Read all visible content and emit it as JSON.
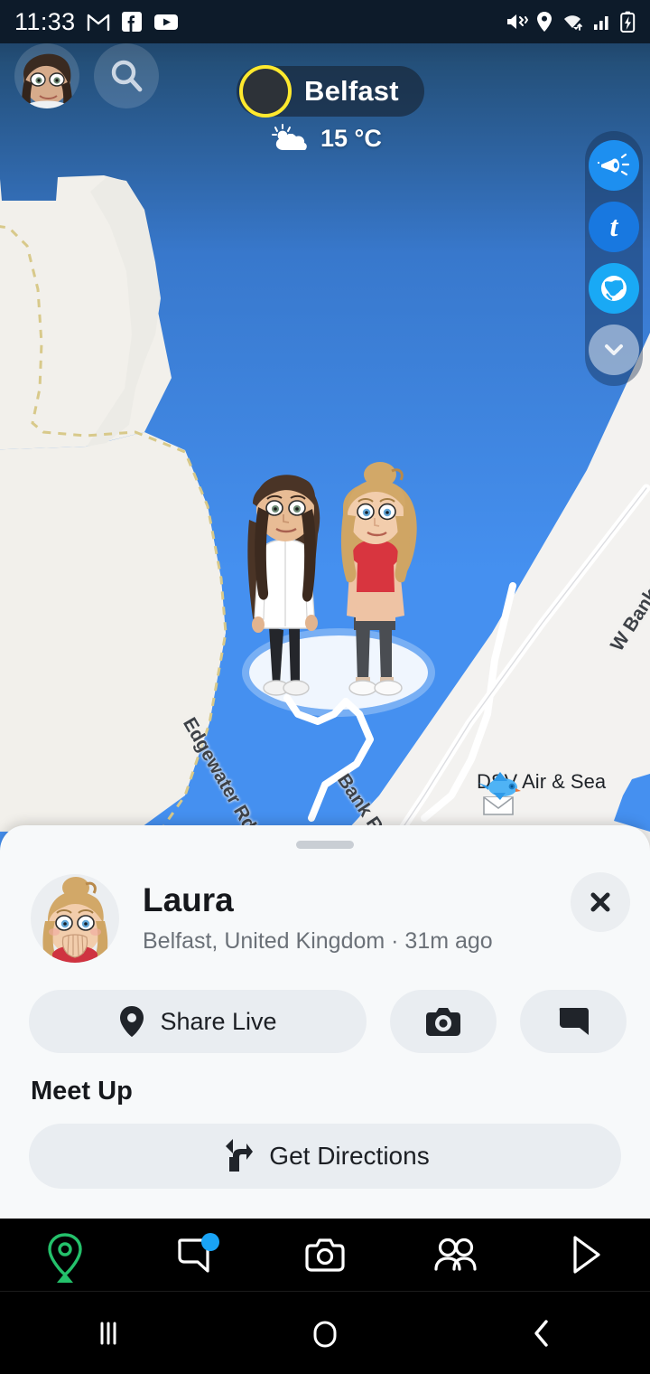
{
  "status_bar": {
    "time": "11:33",
    "left_icons": [
      "gmail-icon",
      "facebook-icon",
      "youtube-icon"
    ],
    "right_icons": [
      "mute-vibrate-icon",
      "location-icon",
      "wifi-icon",
      "cellular-signal-icon",
      "battery-charging-icon"
    ]
  },
  "map": {
    "place_name": "Belfast",
    "temperature": "15 °C",
    "weather_icon": "sun-behind-cloud-icon",
    "search_icon": "search-icon",
    "avatar_icon": "user-bitmoji-avatar",
    "road_labels": [
      {
        "name": "Edgewater Rd."
      },
      {
        "name": "Bank Rd."
      },
      {
        "name": "W Bank R"
      }
    ],
    "poi": {
      "label": "DSV Air & Sea",
      "icon": "bluebird-envelope-icon"
    },
    "water_color": "#4590f0",
    "land_color": "#f3f2f0",
    "ring_color": "#FFE92E"
  },
  "right_rail": {
    "buttons": [
      {
        "name": "megaphone-icon",
        "color": "#1d8ff0"
      },
      {
        "name": "letter-t-icon",
        "color": "#1878e0"
      },
      {
        "name": "globe-icon",
        "color": "#19a9f5"
      },
      {
        "name": "chevron-down-icon",
        "color": "#9fb5cd"
      }
    ]
  },
  "sheet": {
    "friend_name": "Laura",
    "friend_subtitle": "Belfast, United Kingdom · 31m ago",
    "close_label": "✕",
    "avatar_icon": "laura-bitmoji-avatar",
    "actions": [
      {
        "label": "Share Live",
        "icon": "location-pin-icon"
      },
      {
        "label": "",
        "icon": "camera-icon"
      },
      {
        "label": "",
        "icon": "chat-bubble-icon"
      }
    ],
    "meet_up_heading": "Meet Up",
    "directions_label": "Get Directions",
    "directions_icon": "directions-arrow-icon"
  },
  "app_nav": {
    "items": [
      {
        "name": "map-tab",
        "icon": "map-pin-icon",
        "active": true,
        "badge": false
      },
      {
        "name": "chat-tab",
        "icon": "chat-bubble-icon",
        "active": false,
        "badge": true
      },
      {
        "name": "camera-tab",
        "icon": "camera-icon",
        "active": false,
        "badge": false
      },
      {
        "name": "friends-tab",
        "icon": "friends-icon",
        "active": false,
        "badge": false
      },
      {
        "name": "spotlight-tab",
        "icon": "play-triangle-icon",
        "active": false,
        "badge": false
      }
    ],
    "active_color": "#24c16b",
    "badge_color": "#19a3f5"
  },
  "system_nav": {
    "recents": "recents-icon",
    "home": "home-icon",
    "back": "back-icon"
  }
}
